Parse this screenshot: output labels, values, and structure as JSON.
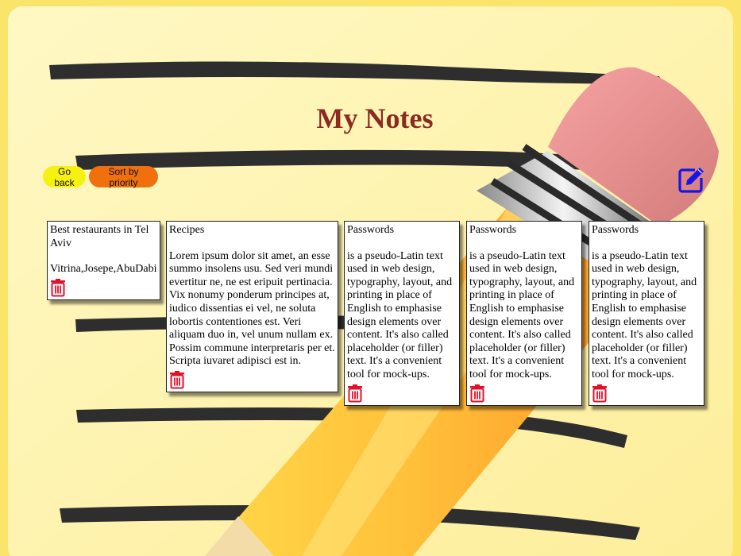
{
  "page": {
    "title": "My Notes"
  },
  "toolbar": {
    "back_label": "Go back",
    "sort_label": "Sort by priority"
  },
  "icons": {
    "edit": "edit-note-icon",
    "delete": "trash-icon"
  },
  "colors": {
    "title": "#8b2a20",
    "back_button": "#f7f112",
    "sort_button": "#f0700e",
    "edit_icon": "#1515e6",
    "trash_icon": "#e3102a"
  },
  "notes": [
    {
      "title": "Best restaurants in Tel Aviv",
      "body": "Vitrina,Josepe,AbuDabi"
    },
    {
      "title": "Recipes",
      "body": "Lorem ipsum dolor sit amet, an esse summo insolens usu. Sed veri mundi evertitur ne, ne est eripuit pertinacia. Vix nonumy ponderum principes at, iudico dissentias ei vel, ne soluta lobortis contentiones est. Veri aliquam duo in, vel unum nullam ex. Possim commune interpretaris per et. Scripta iuvaret adipisci est in."
    },
    {
      "title": "Passwords",
      "body": "is a pseudo-Latin text used in web design, typography, layout, and printing in place of English to emphasise design elements over content. It's also called placeholder (or filler) text. It's a convenient tool for mock-ups."
    },
    {
      "title": "Passwords",
      "body": "is a pseudo-Latin text used in web design, typography, layout, and printing in place of English to emphasise design elements over content. It's also called placeholder (or filler) text. It's a convenient tool for mock-ups."
    },
    {
      "title": "Passwords",
      "body": "is a pseudo-Latin text used in web design, typography, layout, and printing in place of English to emphasise design elements over content. It's also called placeholder (or filler) text. It's a convenient tool for mock-ups."
    }
  ]
}
